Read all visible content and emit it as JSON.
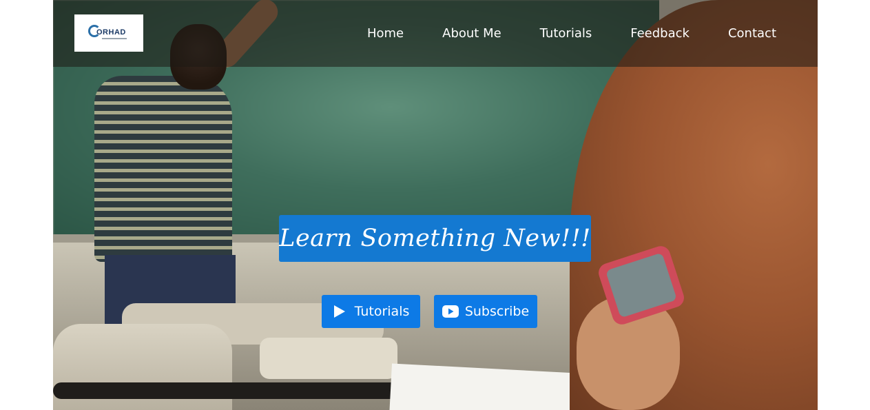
{
  "brand": {
    "logo_text": "ORHAD",
    "logo_icon": "brand-logo-icon"
  },
  "nav": {
    "items": [
      {
        "label": "Home"
      },
      {
        "label": "About Me"
      },
      {
        "label": "Tutorials"
      },
      {
        "label": "Feedback"
      },
      {
        "label": "Contact"
      }
    ]
  },
  "hero": {
    "headline": "Learn Something New!!!",
    "buttons": {
      "tutorials": {
        "label": "Tutorials",
        "icon": "play-icon"
      },
      "subscribe": {
        "label": "Subscribe",
        "icon": "youtube-icon"
      }
    },
    "background_image": "classroom-photo"
  },
  "colors": {
    "accent": "#1479d1",
    "button": "#0d7ae6",
    "nav_overlay": "#1e1914",
    "text_light": "#ffffff"
  }
}
